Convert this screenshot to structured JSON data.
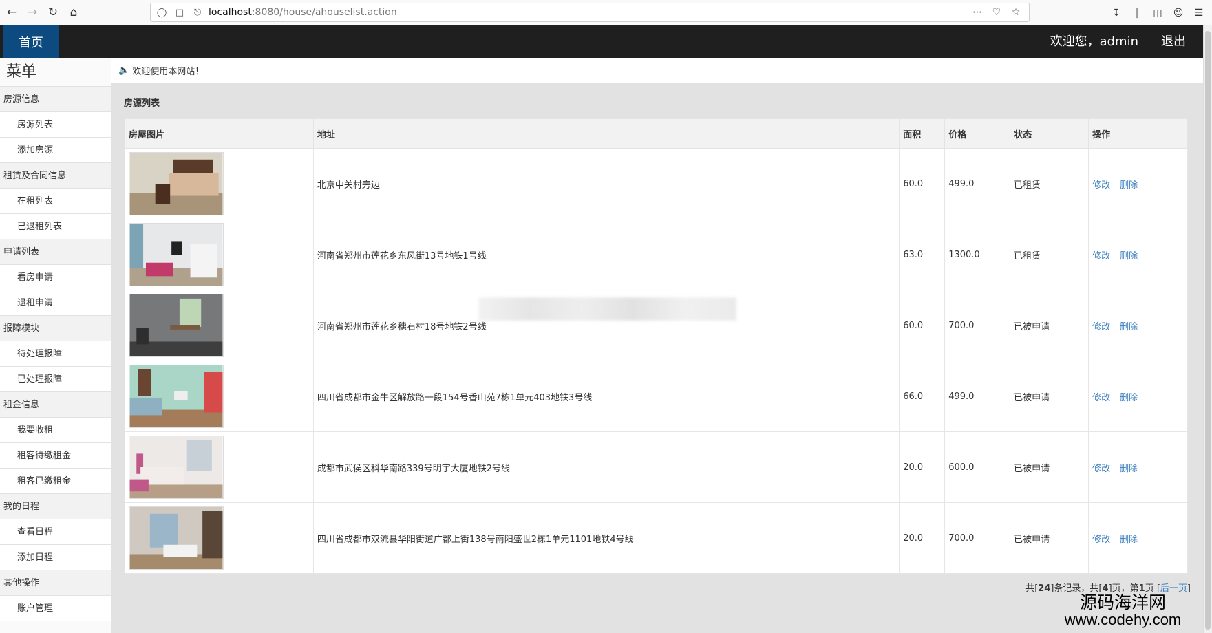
{
  "browser": {
    "url_host": "localhost",
    "url_path": ":8080/house/ahouselist.action"
  },
  "header": {
    "home_tab": "首页",
    "welcome": "欢迎您，admin",
    "logout": "退出"
  },
  "sidebar": {
    "title": "菜单",
    "groups": [
      {
        "label": "房源信息",
        "items": [
          "房源列表",
          "添加房源"
        ]
      },
      {
        "label": "租赁及合同信息",
        "items": [
          "在租列表",
          "已退租列表"
        ]
      },
      {
        "label": "申请列表",
        "items": [
          "看房申请",
          "退租申请"
        ]
      },
      {
        "label": "报障模块",
        "items": [
          "待处理报障",
          "已处理报障"
        ]
      },
      {
        "label": "租金信息",
        "items": [
          "我要收租",
          "租客待缴租金",
          "租客已缴租金"
        ]
      },
      {
        "label": "我的日程",
        "items": [
          "查看日程",
          "添加日程"
        ]
      },
      {
        "label": "其他操作",
        "items": [
          "账户管理"
        ]
      }
    ]
  },
  "notice": "欢迎使用本网站！",
  "panel": {
    "title": "房源列表",
    "columns": [
      "房屋图片",
      "地址",
      "面积",
      "价格",
      "状态",
      "操作"
    ],
    "rows": [
      {
        "address": "北京中关村旁边",
        "area": "60.0",
        "price": "499.0",
        "status": "已租赁",
        "edit": "修改",
        "delete": "删除"
      },
      {
        "address": "河南省郑州市莲花乡东风街13号地铁1号线",
        "area": "63.0",
        "price": "1300.0",
        "status": "已租赁",
        "edit": "修改",
        "delete": "删除"
      },
      {
        "address": "河南省郑州市莲花乡穗石村18号地铁2号线",
        "area": "60.0",
        "price": "700.0",
        "status": "已被申请",
        "edit": "修改",
        "delete": "删除"
      },
      {
        "address": "四川省成都市金牛区解放路一段154号香山苑7栋1单元403地铁3号线",
        "area": "66.0",
        "price": "499.0",
        "status": "已被申请",
        "edit": "修改",
        "delete": "删除"
      },
      {
        "address": "成都市武侯区科华南路339号明宇大厦地铁2号线",
        "area": "20.0",
        "price": "600.0",
        "status": "已被申请",
        "edit": "修改",
        "delete": "删除"
      },
      {
        "address": "四川省成都市双流县华阳街道广都上街138号南阳盛世2栋1单元1101地铁4号线",
        "area": "20.0",
        "price": "700.0",
        "status": "已被申请",
        "edit": "修改",
        "delete": "删除"
      }
    ]
  },
  "pager": {
    "prefix": "共[",
    "total_records": "24",
    "mid1": "]条记录，共[",
    "total_pages": "4",
    "mid2": "]页，第",
    "current_page": "1",
    "mid3": "页 [",
    "next": "后一页",
    "suffix": "]"
  },
  "watermark": {
    "line1": "源码海洋网",
    "line2": "www.codehy.com"
  },
  "icons": {
    "back": "back-arrow-icon",
    "forward": "forward-arrow-icon",
    "reload": "reload-icon",
    "home": "home-icon",
    "speaker": "speaker-icon"
  },
  "colors": {
    "topbar": "#1f1f1f",
    "home_tab": "#0c4a80",
    "link": "#3a7fc1"
  }
}
